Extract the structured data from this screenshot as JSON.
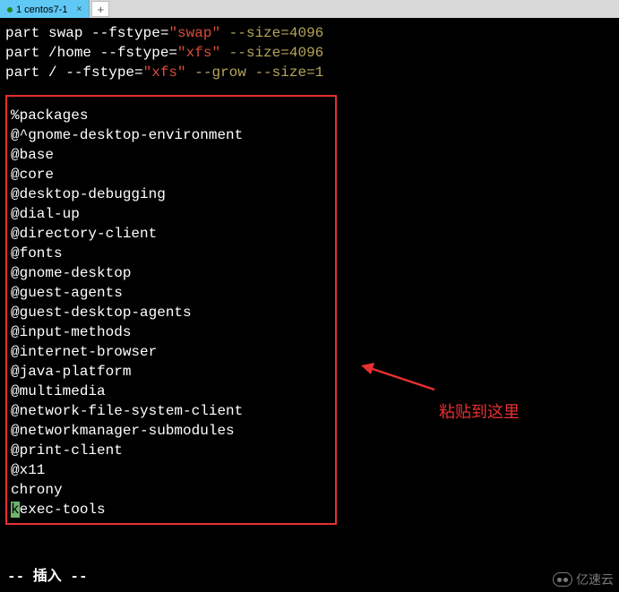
{
  "tab": {
    "label": "1 centos7-1",
    "close": "×",
    "add": "+"
  },
  "commands": {
    "line1_a": "part swap --fstype=",
    "line1_b": "\"swap\"",
    "line1_c": " --size=4096",
    "line2_a": "part /home --fstype=",
    "line2_b": "\"xfs\"",
    "line2_c": " --size=4096",
    "line3_a": "part / --fstype=",
    "line3_b": "\"xfs\"",
    "line3_c": " --grow --size=1"
  },
  "packages": [
    "%packages",
    "@^gnome-desktop-environment",
    "@base",
    "@core",
    "@desktop-debugging",
    "@dial-up",
    "@directory-client",
    "@fonts",
    "@gnome-desktop",
    "@guest-agents",
    "@guest-desktop-agents",
    "@input-methods",
    "@internet-browser",
    "@java-platform",
    "@multimedia",
    "@network-file-system-client",
    "@networkmanager-submodules",
    "@print-client",
    "@x11",
    "chrony"
  ],
  "cursor_line": {
    "cursor_char": "k",
    "rest": "exec-tools"
  },
  "annotation": {
    "text": "粘贴到这里"
  },
  "status": "-- 插入 --",
  "watermark": "亿速云"
}
